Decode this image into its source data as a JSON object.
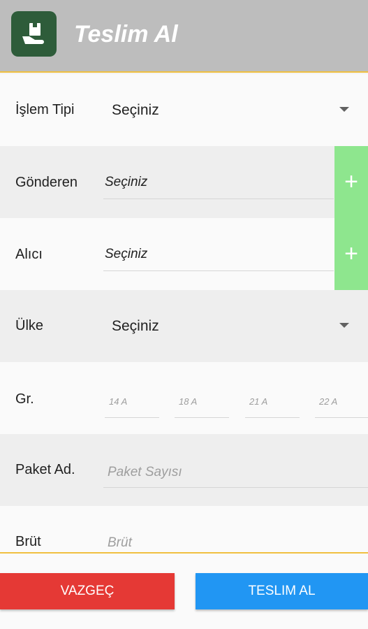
{
  "appbar": {
    "title": "Teslim Al",
    "icon": "box-hand-icon"
  },
  "form": {
    "islem_tipi": {
      "label": "İşlem Tipi",
      "value": "Seçiniz"
    },
    "gonderen": {
      "label": "Gönderen",
      "value": "Seçiniz",
      "add": "+"
    },
    "alici": {
      "label": "Alıcı",
      "value": "Seçiniz",
      "add": "+"
    },
    "ulke": {
      "label": "Ülke",
      "value": "Seçiniz"
    },
    "gr": {
      "label": "Gr.",
      "placeholders": [
        "14 A",
        "18 A",
        "21 A",
        "22 A"
      ]
    },
    "paket": {
      "label": "Paket Ad.",
      "placeholder": "Paket Sayısı"
    },
    "brut": {
      "label": "Brüt",
      "placeholder": "Brüt"
    }
  },
  "actions": {
    "cancel": "VAZGEÇ",
    "submit": "TESLIM AL"
  },
  "colors": {
    "appbar": "#bdbdbd",
    "app_icon": "#2e5c3a",
    "add_button": "#8ee68e",
    "cancel_button": "#e53935",
    "submit_button": "#2196f3",
    "divider": "#f0c040"
  }
}
